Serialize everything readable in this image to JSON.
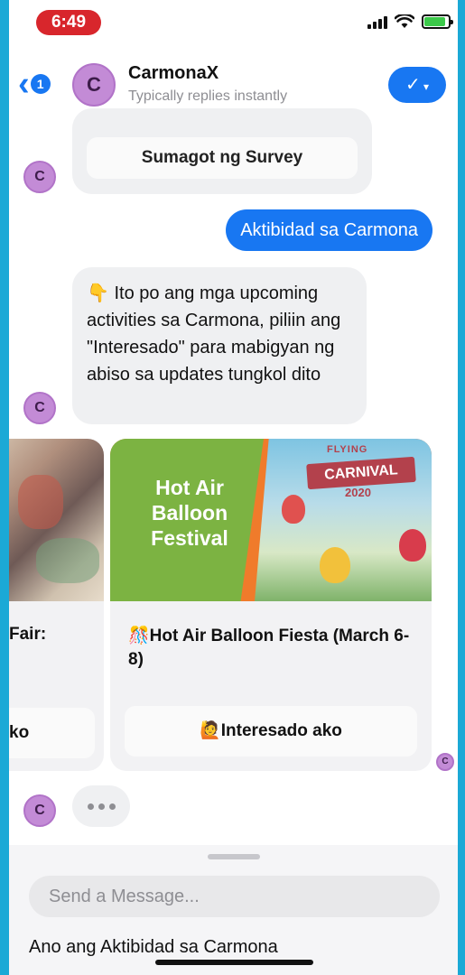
{
  "status_bar": {
    "time": "6:49",
    "battery_level": 0.9,
    "battery_color": "#3cc94a"
  },
  "header": {
    "back_badge": "1",
    "avatar_letter": "C",
    "title": "CarmonaX",
    "subtitle": "Typically replies instantly",
    "accent_color": "#1877f2"
  },
  "messages": {
    "prev_card_button": "Sumagot ng Survey",
    "user_message": "Aktibidad sa Carmona",
    "bot_text": "👇 Ito po ang mga upcoming activities sa Carmona, piliin ang \"Interesado\" para mabigyan ng abiso sa updates tungkol dito",
    "avatar_letter": "C"
  },
  "carousel": [
    {
      "title": "Fair:",
      "button": "ko"
    },
    {
      "image_text": "Hot Air Balloon Festival",
      "poster_top": "FLYING",
      "poster_banner": "CARNIVAL",
      "poster_year": "2020",
      "title": "🎊Hot Air Balloon Fiesta (March 6-8)",
      "button": "🙋Interesado ako"
    }
  ],
  "composer": {
    "placeholder": "Send a Message...",
    "suggestion": "Ano ang Aktibidad sa Carmona"
  }
}
